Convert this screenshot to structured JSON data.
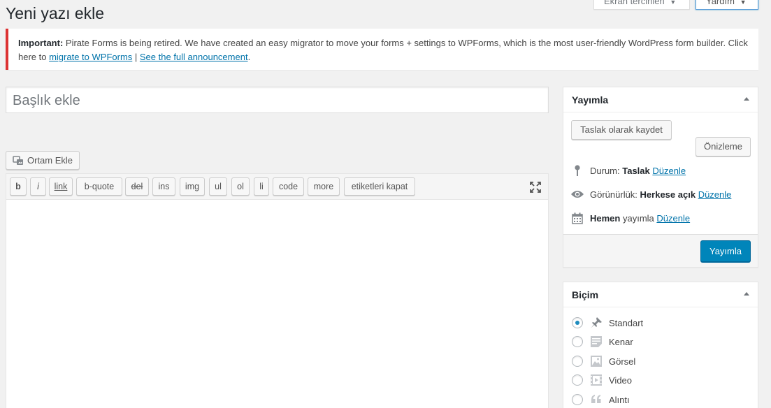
{
  "screen_tabs": {
    "options_label": "Ekran tercihleri",
    "help_label": "Yardım"
  },
  "page_title": "Yeni yazı ekle",
  "notice": {
    "strong": "Important:",
    "text1": " Pirate Forms is being retired. We have created an easy migrator to move your forms + settings to WPForms, which is the most user-friendly WordPress form builder. Click here to ",
    "link1": "migrate to WPForms",
    "sep": " | ",
    "link2": "See the full announcement",
    "end": "."
  },
  "title_placeholder": "Başlık ekle",
  "media_button": "Ortam Ekle",
  "quicktags": [
    "b",
    "i",
    "link",
    "b-quote",
    "del",
    "ins",
    "img",
    "ul",
    "ol",
    "li",
    "code",
    "more",
    "etiketleri kapat"
  ],
  "publish": {
    "title": "Yayımla",
    "save_draft": "Taslak olarak kaydet",
    "preview": "Önizleme",
    "status_label": "Durum:",
    "status_value": "Taslak",
    "visibility_label": "Görünürlük:",
    "visibility_value": "Herkese açık",
    "schedule_strong": "Hemen",
    "schedule_text": "yayımla",
    "edit_link": "Düzenle",
    "publish_button": "Yayımla"
  },
  "format": {
    "title": "Biçim",
    "options": [
      "Standart",
      "Kenar",
      "Görsel",
      "Video",
      "Alıntı"
    ],
    "selected": "Standart"
  }
}
